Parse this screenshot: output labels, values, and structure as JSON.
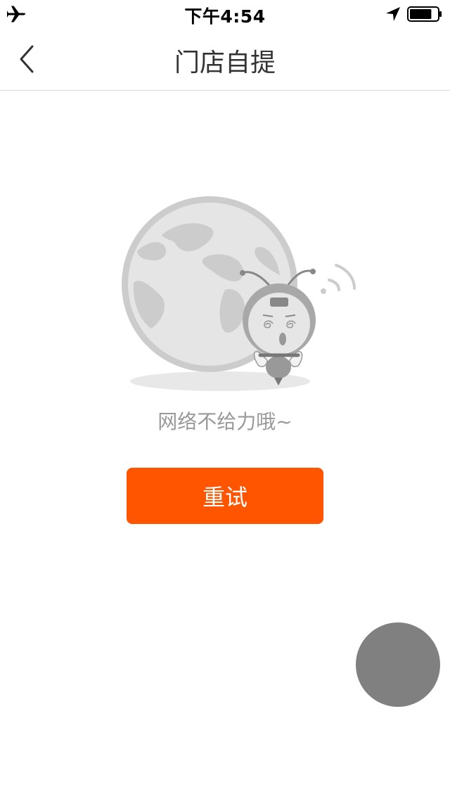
{
  "status_bar": {
    "time": "下午4:54",
    "icons": [
      "airplane-icon",
      "location-arrow-icon",
      "battery-icon"
    ],
    "battery_level": 0.8
  },
  "nav": {
    "title": "门店自提",
    "back_icon": "chevron-left-icon"
  },
  "error": {
    "illustration": "globe-and-bee-mascot-offline",
    "message": "网络不给力哦~"
  },
  "actions": {
    "retry_label": "重试"
  },
  "floating_button": {
    "icon": "floating-assist-circle"
  },
  "colors": {
    "accent": "#ff5500",
    "muted_text": "#999999",
    "illustration_gray": "#cccccc",
    "float_button": "#808080"
  }
}
